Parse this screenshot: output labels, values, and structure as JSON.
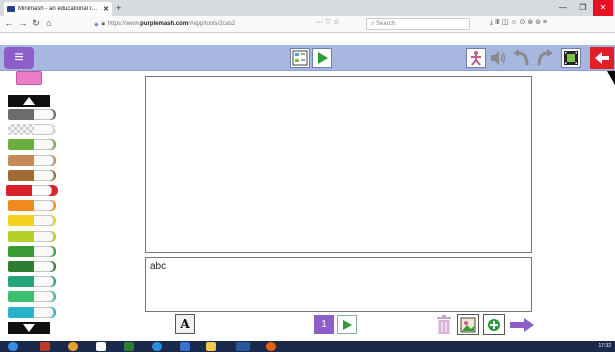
{
  "browser": {
    "tab_title": "Minimash - an educational resou",
    "tab_close": "✕",
    "new_tab": "+",
    "url_prefix": "https://www.",
    "url_domain": "purplemash.com",
    "url_path": "/#app/tools/2cas2",
    "search_placeholder": "Search",
    "page_actions": "··· ♡ ☆",
    "toolbar_icons": "⤓ Ⅲ ◫ ☺ ⊙ ⊛ ⊜ ≡",
    "window_controls": [
      "—",
      "❐",
      "✕"
    ],
    "nav": [
      "←",
      "→",
      "↻",
      "⌂"
    ]
  },
  "app": {
    "menu_icon": "≡",
    "text_sample": "abc",
    "font_button": "A",
    "page_number": "1",
    "exit_color": "#e01f29",
    "accent_color": "#8d5ec7",
    "appbar_color": "#a7b7e0"
  },
  "palette": {
    "selected_color": "#ec7cc5",
    "pens": [
      {
        "name": "grey",
        "color": "#6c6c6c"
      },
      {
        "name": "checker-transparent",
        "color": "#bdbdbd"
      },
      {
        "name": "grass-texture",
        "color": "#6bae3f"
      },
      {
        "name": "brick-texture",
        "color": "#c48a5a"
      },
      {
        "name": "wood-texture",
        "color": "#a06a35"
      },
      {
        "name": "red",
        "color": "#d8232a"
      },
      {
        "name": "orange",
        "color": "#f08a1c"
      },
      {
        "name": "yellow",
        "color": "#f2d21f"
      },
      {
        "name": "lime",
        "color": "#b7cf2a"
      },
      {
        "name": "green",
        "color": "#3a9b35"
      },
      {
        "name": "dark-green",
        "color": "#2e7d32"
      },
      {
        "name": "teal",
        "color": "#25a37a"
      },
      {
        "name": "light-green",
        "color": "#3dbf6f"
      },
      {
        "name": "cyan",
        "color": "#26b2c9"
      }
    ]
  },
  "taskbar": {
    "clock": "17:32"
  }
}
